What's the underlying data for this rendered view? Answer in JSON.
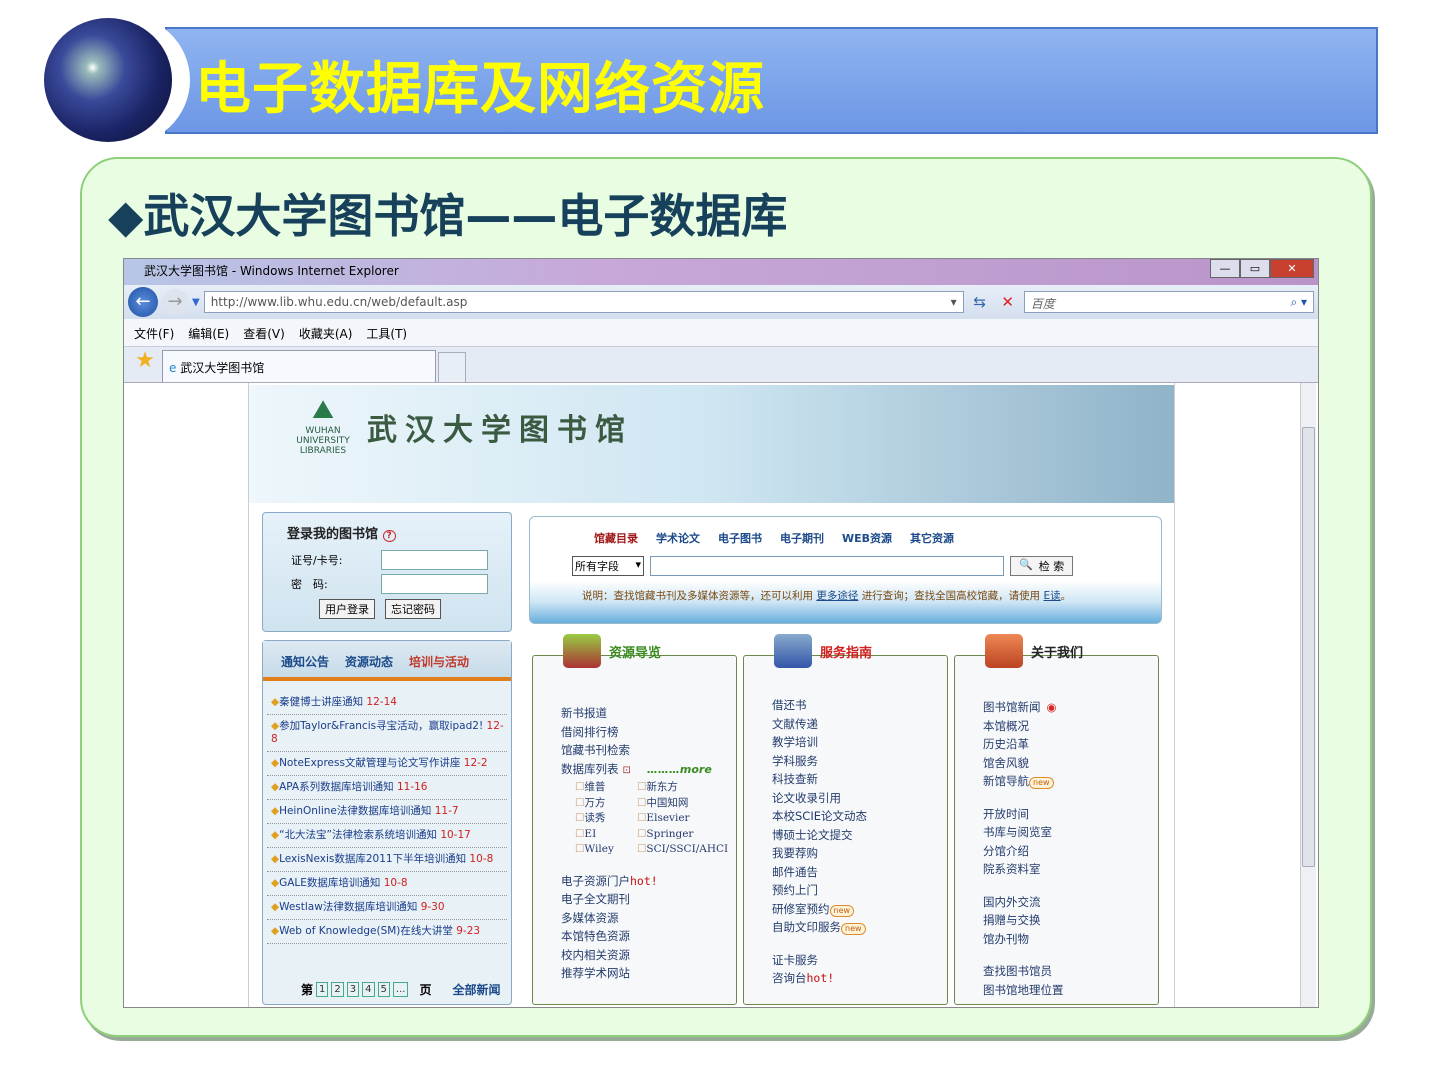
{
  "slide": {
    "title": "电子数据库及网络资源",
    "subtitle": "◆武汉大学图书馆——电子数据库"
  },
  "browser": {
    "window_title": "武汉大学图书馆 - Windows Internet Explorer",
    "url": "http://www.lib.whu.edu.cn/web/default.asp",
    "search_placeholder": "百度",
    "menu": [
      "文件(F)",
      "编辑(E)",
      "查看(V)",
      "收藏夹(A)",
      "工具(T)"
    ],
    "tab_title": "武汉大学图书馆"
  },
  "library": {
    "logo_text": "WUHAN UNIVERSITY LIBRARIES",
    "name": "武汉大学图书馆",
    "login": {
      "title": "登录我的图书馆",
      "help": "?",
      "card_label": "证号/卡号:",
      "password_label": "密　码:",
      "login_button": "用户登录",
      "forgot_button": "忘记密码"
    },
    "news": {
      "tabs": [
        "通知公告",
        "资源动态",
        "培训与活动"
      ],
      "items": [
        {
          "title": "秦健博士讲座通知",
          "date": "12-14"
        },
        {
          "title": "参加Taylor&Francis寻宝活动，赢取ipad2!",
          "date": "12-8"
        },
        {
          "title": "NoteExpress文献管理与论文写作讲座",
          "date": "12-2"
        },
        {
          "title": "APA系列数据库培训通知",
          "date": "11-16"
        },
        {
          "title": "HeinOnline法律数据库培训通知",
          "date": "11-7"
        },
        {
          "title": "“北大法宝”法律检索系统培训通知",
          "date": "10-17"
        },
        {
          "title": "LexisNexis数据库2011下半年培训通知",
          "date": "10-8"
        },
        {
          "title": "GALE数据库培训通知",
          "date": "10-8"
        },
        {
          "title": "Westlaw法律数据库培训通知",
          "date": "9-30"
        },
        {
          "title": "Web of Knowledge(SM)在线大讲堂",
          "date": "9-23"
        }
      ],
      "pager": {
        "prefix": "第",
        "pages": [
          "1",
          "2",
          "3",
          "4",
          "5",
          "..."
        ],
        "suffix": "页",
        "all": "全部新闻"
      }
    },
    "search": {
      "tabs": [
        "馆藏目录",
        "学术论文",
        "电子图书",
        "电子期刊",
        "WEB资源",
        "其它资源"
      ],
      "field_select": "所有字段",
      "button": "检 索",
      "note_prefix": "说明：查找馆藏书刊及多媒体资源等，还可以利用",
      "note_link1": "更多途径",
      "note_mid": "进行查询；查找全国高校馆藏，请使用",
      "note_link2": "E读",
      "note_end": "。"
    },
    "resources": {
      "title": "资源导览",
      "links_top": [
        "新书报道",
        "借阅排行榜",
        "馆藏书刊检索"
      ],
      "db_list_label": "数据库列表",
      "more": "………more",
      "databases": [
        "维普",
        "新东方",
        "万方",
        "中国知网",
        "读秀",
        "Elsevier",
        "EI",
        "Springer",
        "Wiley",
        "SCI/SSCI/AHCI"
      ],
      "portal": "电子资源门户",
      "hot": "hot!",
      "links_bottom": [
        "电子全文期刊",
        "多媒体资源",
        "本馆特色资源",
        "校内相关资源",
        "推荐学术网站"
      ]
    },
    "services": {
      "title": "服务指南",
      "links": [
        "借还书",
        "文献传递",
        "教学培训",
        "学科服务",
        "科技查新",
        "论文收录引用",
        "本校SCIE论文动态",
        "博硕士论文提交",
        "我要荐购",
        "邮件通告",
        "预约上门"
      ],
      "new_links": [
        "研修室预约",
        "自助文印服务"
      ],
      "new_badge": "new",
      "links2": [
        "证卡服务"
      ],
      "consult": "咨询台",
      "hot": "hot!"
    },
    "about": {
      "title": "关于我们",
      "groups": [
        [
          "图书馆新闻",
          "本馆概况",
          "历史沿革",
          "馆舍风貌",
          "新馆导航"
        ],
        [
          "开放时间",
          "书库与阅览室",
          "分馆介绍",
          "院系资料室"
        ],
        [
          "国内外交流",
          "捐赠与交换",
          "馆办刊物"
        ],
        [
          "查找图书馆员",
          "图书馆地理位置"
        ]
      ],
      "new_badge": "new"
    }
  }
}
